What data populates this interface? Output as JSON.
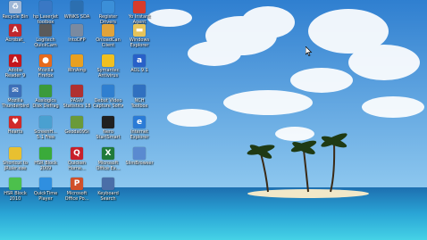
{
  "desktop": {
    "icons": [
      {
        "line1": "Recycle Bin",
        "line2": "",
        "icon": "recycle-bin-icon",
        "color": "#9fb7d6"
      },
      {
        "line1": "hp LaserJet",
        "line2": "toolbox",
        "icon": "printer-icon",
        "color": "#3a78c4"
      },
      {
        "line1": "WINKS SDA",
        "line2": "",
        "icon": "winks-icon",
        "color": "#2c6fb0"
      },
      {
        "line1": "Register",
        "line2": "Drivers",
        "icon": "register-icon",
        "color": "#3b8fd8"
      },
      {
        "line1": "Yo Instant",
        "line2": "Agent",
        "icon": "agent-icon",
        "color": "#d63b2b"
      },
      {
        "line1": "Acrobat_",
        "line2": "",
        "icon": "acrobat-icon",
        "color": "#c0282d"
      },
      {
        "line1": "Logitech",
        "line2": "QuickCam",
        "icon": "webcam-icon",
        "color": "#5a5a5a"
      },
      {
        "line1": "IntoDFP",
        "line2": "",
        "icon": "wrench-icon",
        "color": "#7a8aa0"
      },
      {
        "line1": "OnloadCan",
        "line2": "Client",
        "icon": "client-icon",
        "color": "#e0a33a"
      },
      {
        "line1": "Windows",
        "line2": "Explorer",
        "icon": "folder-icon",
        "color": "#e6c35a"
      },
      {
        "line1": "Adobe",
        "line2": "Reader 9",
        "icon": "adobe-reader-icon",
        "color": "#c4161c"
      },
      {
        "line1": "Mozilla",
        "line2": "Firefox",
        "icon": "firefox-icon",
        "color": "#e66a1c"
      },
      {
        "line1": "WinAmp",
        "line2": "",
        "icon": "winamp-icon",
        "color": "#e8a020"
      },
      {
        "line1": "Symantec",
        "line2": "Antivirus",
        "icon": "shield-icon",
        "color": "#f0c020"
      },
      {
        "line1": "AOL 9.1",
        "line2": "",
        "icon": "aol-icon",
        "color": "#2860c8"
      },
      {
        "line1": "Mozilla",
        "line2": "Thunderbird",
        "icon": "thunderbird-icon",
        "color": "#3d6fb8"
      },
      {
        "line1": "Auslogics",
        "line2": "Disk Defrag",
        "icon": "defrag-icon",
        "color": "#3b9a3b"
      },
      {
        "line1": "PASW",
        "line2": "Statistics 18",
        "icon": "statistics-icon",
        "color": "#b03030"
      },
      {
        "line1": "Debut Video",
        "line2": "Capture Software",
        "icon": "video-capture-icon",
        "color": "#2f7fd0"
      },
      {
        "line1": "NCH",
        "line2": "Toolbox",
        "icon": "toolbox-icon",
        "color": "#3070c0"
      },
      {
        "line1": "Hearts",
        "line2": "",
        "icon": "hearts-icon",
        "color": "#d02a2a"
      },
      {
        "line1": "ScreenH...",
        "line2": "5.1 Free",
        "icon": "screenshot-icon",
        "color": "#4aa0d0"
      },
      {
        "line1": "Geoda095i",
        "line2": "",
        "icon": "geoda-icon",
        "color": "#6a9a3a"
      },
      {
        "line1": "Nero",
        "line2": "StartSmart",
        "icon": "nero-icon",
        "color": "#202020"
      },
      {
        "line1": "Internet",
        "line2": "Explorer",
        "icon": "internet-explorer-icon",
        "color": "#2b7bd6"
      },
      {
        "line1": "Shortcut to",
        "line2": "JRuler.exe",
        "icon": "ruler-icon",
        "color": "#e8c030"
      },
      {
        "line1": "HSR Block",
        "line2": "2009",
        "icon": "green-block-icon",
        "color": "#3aab3a"
      },
      {
        "line1": "Quicken",
        "line2": "Home...",
        "icon": "quicken-icon",
        "color": "#c8202a"
      },
      {
        "line1": "Microsoft",
        "line2": "Office Ex...",
        "icon": "excel-icon",
        "color": "#207a3a"
      },
      {
        "line1": "SlimBrowser",
        "line2": "",
        "icon": "browser-icon",
        "color": "#5a8ad0"
      },
      {
        "line1": "HSR Block",
        "line2": "2010",
        "icon": "green-block-icon",
        "color": "#4cc04c"
      },
      {
        "line1": "QuickTime",
        "line2": "Player",
        "icon": "quicktime-icon",
        "color": "#2f8fe0"
      },
      {
        "line1": "Microsoft",
        "line2": "Office Po...",
        "icon": "powerpoint-icon",
        "color": "#d0502a"
      },
      {
        "line1": "Keyboard",
        "line2": "Search",
        "icon": "keyboard-icon",
        "color": "#4a6ea8"
      }
    ],
    "glyph_letters": {
      "acrobat-icon": "A",
      "adobe-reader-icon": "A",
      "quicken-icon": "Q",
      "excel-icon": "X",
      "powerpoint-icon": "P",
      "hearts-icon": "♥",
      "internet-explorer-icon": "e",
      "aol-icon": "a",
      "firefox-icon": "●",
      "thunderbird-icon": "✉",
      "recycle-bin-icon": "♻",
      "folder-icon": "▬"
    }
  },
  "colors": {
    "sky_top": "#2f7fd0",
    "sky_bottom": "#8ec8ef",
    "sea_deep": "#1f7fc0",
    "sea_light": "#37c7e0",
    "sand": "#f2e8c8"
  }
}
